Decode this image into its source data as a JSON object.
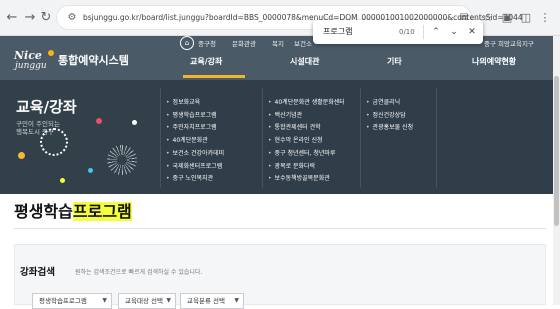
{
  "browser": {
    "url": "bsjunggu.go.kr/board/list.junggu?boardId=BBS_0000078&menuCd=DOM_000001001002000000&contentsSid=1044",
    "find": {
      "query": "프로그램",
      "count": "0/10"
    }
  },
  "site": {
    "logo_line1": "Nice",
    "logo_line2": "junggu",
    "name": "통합예약시스템",
    "util_links": [
      "중구청",
      "문화관광",
      "복지",
      "보건소",
      "중구 희망교육지구"
    ],
    "main_nav": [
      "교육/강좌",
      "시설대관",
      "기타",
      "나의예약현황"
    ]
  },
  "mega_menu": {
    "title": "교육/강좌",
    "subtitle_line1": "구민이 주인되는",
    "subtitle_line2": "행복도시 중구",
    "col1": [
      "정보화교육",
      "평생학습프로그램",
      "주민자치프로그램",
      "40계단문화관",
      "보건소 건강아카데미",
      "국제화센터프로그램",
      "중구 노인복지관"
    ],
    "col2": [
      "40계단문화관 생활문화센터",
      "백산기념관",
      "통합관제센터 견학",
      "현수막 온라인 신청",
      "중구 청년센터, 청년마루",
      "광복로 문화다락",
      "보수동책방골목문화관"
    ],
    "col3": [
      "금연클리닉",
      "정신건강상담",
      "관광홍보물 신청"
    ]
  },
  "page": {
    "title_plain": "평생학습",
    "title_highlight": "프로그램"
  },
  "search": {
    "title": "강좌검색",
    "desc": "원하는 검색조건으로 빠르게 검색하실 수 있습니다.",
    "selects": [
      "평생학습프로그램",
      "교육대상 선택",
      "교육분류 선택"
    ]
  },
  "colors": {
    "header_bg": "#4b5a67",
    "mega_bg": "#2f3e48",
    "accent": "#f2b32e",
    "highlight": "#f5ff3d"
  }
}
